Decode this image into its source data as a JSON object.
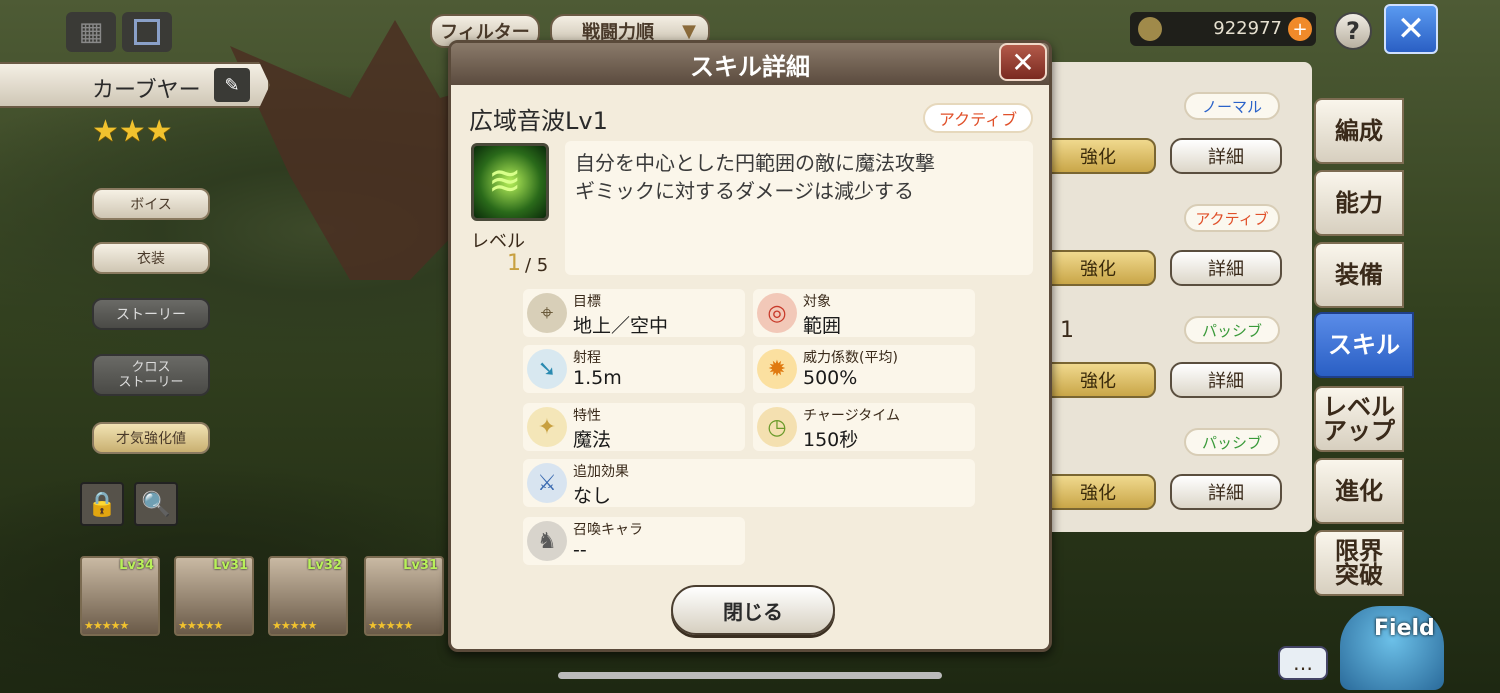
{
  "header": {
    "filter_label": "フィルター",
    "sort_label": "戦闘力順",
    "currency_value": "922977",
    "help_label": "?",
    "close_label": "✕"
  },
  "character": {
    "name": "カーブヤー",
    "stars": "★★★"
  },
  "left_menu": {
    "voice": "ボイス",
    "costume": "衣装",
    "story": "ストーリー",
    "cross_story": "クロス\nストーリー",
    "talent": "才気強化値"
  },
  "party": [
    {
      "level": "Lv34",
      "stars": "★★★★★"
    },
    {
      "level": "Lv31",
      "stars": "★★★★★"
    },
    {
      "level": "Lv32",
      "stars": "★★★★★"
    },
    {
      "level": "Lv31",
      "stars": "★★★★★"
    }
  ],
  "skill_list": {
    "rows": [
      {
        "tag": "ノーマル",
        "strengthen": "強化",
        "detail": "詳細"
      },
      {
        "tag": "アクティブ",
        "strengthen": "強化",
        "detail": "詳細"
      },
      {
        "tag": "パッシブ",
        "strengthen": "強化",
        "detail": "詳細"
      },
      {
        "tag": "パッシブ",
        "strengthen": "強化",
        "detail": "詳細"
      }
    ],
    "partial_text": "1"
  },
  "side_tabs": {
    "formation": "編成",
    "ability": "能力",
    "equipment": "装備",
    "skill": "スキル",
    "level_up": "レベル\nアップ",
    "evolution": "進化",
    "limit_break": "限界\n突破"
  },
  "field_label": "Field",
  "modal": {
    "title": "スキル詳細",
    "skill_name": "広域音波Lv1",
    "type_tag": "アクティブ",
    "level_label": "レベル",
    "level_current": "1",
    "level_max": "/ 5",
    "description_line1": "自分を中心とした円範囲の敵に魔法攻撃",
    "description_line2": "ギミックに対するダメージは減少する",
    "stats": {
      "target_label": "目標",
      "target_value": "地上／空中",
      "scope_label": "対象",
      "scope_value": "範囲",
      "range_label": "射程",
      "range_value": "1.5m",
      "power_label": "威力係数(平均)",
      "power_value": "500%",
      "attribute_label": "特性",
      "attribute_value": "魔法",
      "charge_label": "チャージタイム",
      "charge_value": "150秒",
      "extra_label": "追加効果",
      "extra_value": "なし",
      "summon_label": "召喚キャラ",
      "summon_value": "--"
    },
    "close_button": "閉じる"
  },
  "colors": {
    "accent_blue": "#2a5fc4",
    "active_tag": "#e0502a",
    "normal_tag": "#2a62c9",
    "passive_tag": "#3a9a3a",
    "level_current": "#c8a040"
  }
}
